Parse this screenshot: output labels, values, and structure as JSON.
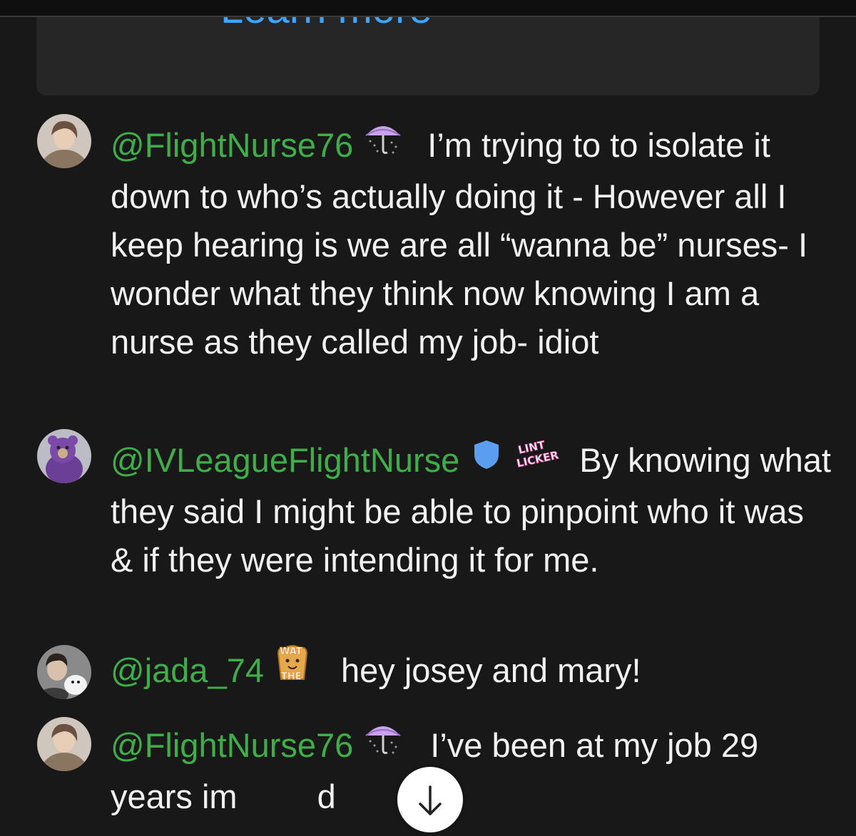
{
  "banner": {
    "link_label": "Learn more"
  },
  "messages": [
    {
      "author": "@FlightNurse76",
      "badges": [
        "umbrella-emoji-badge"
      ],
      "text": "I’m trying to to isolate it down to who’s actually doing it - However all I keep hearing is we are all “wanna be” nurses- I wonder what they think now knowing I am a nurse as they called my job- idiot"
    },
    {
      "author": "@IVLeagueFlightNurse",
      "badges": [
        "moderator-shield-icon",
        "lint-licker-badge"
      ],
      "badge_text": "LINT LICKER",
      "text": "By knowing what they said I might be able to pinpoint who it was & if they were intending it for me."
    },
    {
      "author": "@jada_74",
      "badges": [
        "wat-the-toast-badge"
      ],
      "badge_text": "WAT THE",
      "text": "hey josey and mary!"
    },
    {
      "author": "@FlightNurse76",
      "badges": [
        "umbrella-emoji-badge"
      ],
      "text_before": "I’ve been at my job 29 years im",
      "text_after": "d"
    }
  ],
  "colors": {
    "background": "#181818",
    "author": "#3fae4a",
    "link": "#3ea6ff",
    "text": "#f1f1f1",
    "moderator": "#5b9ef0"
  },
  "icons": {
    "scroll_down": "arrow-down-icon"
  }
}
